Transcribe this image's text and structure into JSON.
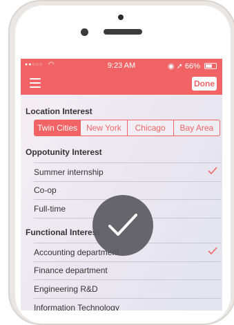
{
  "status_bar": {
    "time": "9:23 AM",
    "battery": "66%"
  },
  "nav": {
    "done_label": "Done"
  },
  "location": {
    "title": "Location Interest",
    "options": [
      "Twin Cities",
      "New York",
      "Chicago",
      "Bay Area"
    ],
    "selected": "Twin Cities"
  },
  "opportunity": {
    "title": "Oppotunity Interest",
    "items": [
      {
        "label": "Summer internship",
        "checked": true
      },
      {
        "label": "Co-op",
        "checked": false
      },
      {
        "label": "Full-time",
        "checked": false
      }
    ]
  },
  "functional": {
    "title": "Functional Interest",
    "items": [
      {
        "label": "Accounting department",
        "checked": true
      },
      {
        "label": "Finance department",
        "checked": false
      },
      {
        "label": "Engineering R&D",
        "checked": false
      },
      {
        "label": "Information Technology",
        "checked": false
      }
    ]
  },
  "colors": {
    "accent": "#f16364"
  },
  "icons": {
    "menu": "hamburger-icon",
    "check": "checkmark-icon",
    "success": "success-checkmark-icon"
  }
}
